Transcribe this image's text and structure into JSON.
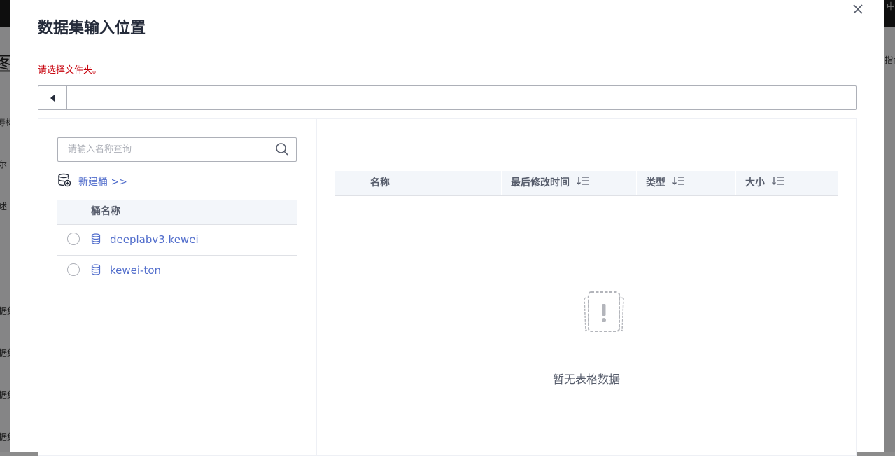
{
  "background": {
    "frag_big": "图信",
    "frag_right_top": "中",
    "frag_right": "指南",
    "frag_1": "寿标",
    "frag_2": "尔",
    "frag_3": "述",
    "frag_4": "据集",
    "frag_5": "据集",
    "frag_6": "据集",
    "frag_7": "据集"
  },
  "dialog": {
    "title": "数据集输入位置",
    "hint": "请选择文件夹。",
    "path_value": "",
    "close_icon": "close-icon"
  },
  "left": {
    "search_placeholder": "请输入名称查询",
    "new_bucket_label": "新建桶 >>",
    "bucket_column": "桶名称",
    "buckets": [
      {
        "name": "deeplabv3.kewei",
        "selected": false
      },
      {
        "name": "kewei-ton",
        "selected": false
      }
    ]
  },
  "right": {
    "columns": [
      "名称",
      "最后修改时间",
      "类型",
      "大小"
    ],
    "empty_text": "暂无表格数据"
  },
  "colors": {
    "link": "#526ecc",
    "hint": "#c7000b",
    "title": "#252b3a"
  }
}
